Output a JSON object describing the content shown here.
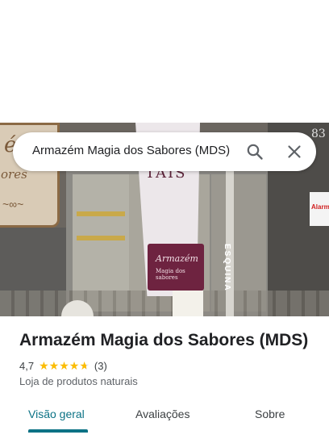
{
  "search": {
    "query": "Armazém Magia dos Sabores (MDS)"
  },
  "photo": {
    "sign_text_1": "é",
    "sign_text_2": "ores",
    "banner_brand": "Armazém",
    "banner_sub": "Magia dos sabores",
    "banner_letters": "UTOS TAIS",
    "corner_text": "ESQUINA",
    "street_number": "83",
    "notice_text": "Alarm"
  },
  "place": {
    "title": "Armazém Magia dos Sabores (MDS)",
    "rating": "4,7",
    "stars": 4.7,
    "review_count": "(3)",
    "category": "Loja de produtos naturais"
  },
  "tabs": [
    {
      "label": "Visão geral",
      "active": true
    },
    {
      "label": "Avaliações",
      "active": false
    },
    {
      "label": "Sobre",
      "active": false
    }
  ],
  "colors": {
    "accent": "#0b7285",
    "star": "#fbbc04"
  }
}
